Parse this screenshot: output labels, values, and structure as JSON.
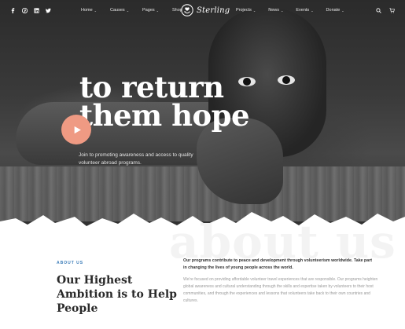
{
  "nav": {
    "social_icons": [
      "facebook-icon",
      "pinterest-icon",
      "linkedin-icon",
      "twitter-icon"
    ],
    "menu_left": [
      "Home",
      "Causes",
      "Pages",
      "Shop"
    ],
    "menu_right": [
      "Projects",
      "News",
      "Events",
      "Donate"
    ],
    "logo_text": "Sterling",
    "right_icons": [
      "search-icon",
      "cart-icon"
    ]
  },
  "hero": {
    "headline_line1": "to return",
    "headline_line2": "them hope",
    "subtext": "Join to promoting awareness and access to quality volunteer abroad programs.",
    "play_color": "#ef9a83"
  },
  "about": {
    "watermark": "about us",
    "eyebrow": "ABOUT US",
    "title": "Our Highest Ambition is to Help People",
    "lead": "Our programs contribute to peace and development through volunteerism worldwide. Take part in changing the lives of young people across the world.",
    "body": "We're focused on providing affordable volunteer travel experiences that are responsible. Our programs heighten global awareness and cultural understanding through the skills and expertise taken by volunteers to their host communities, and through the experiences and lessons that volunteers take back to their own countries and cultures.",
    "accent_color": "#3a7bb8"
  }
}
